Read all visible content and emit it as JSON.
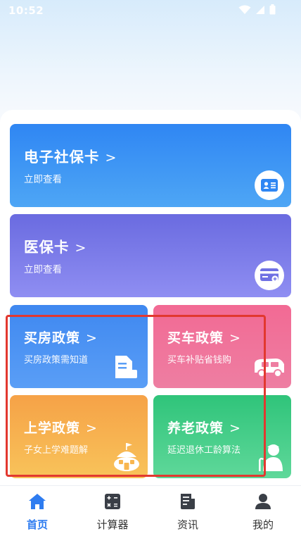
{
  "status_bar": {
    "time": "10:52"
  },
  "cards": {
    "social_security": {
      "title": "电子社保卡",
      "subtitle": "立即查看"
    },
    "medical": {
      "title": "医保卡",
      "subtitle": "立即查看"
    },
    "housing": {
      "title": "买房政策",
      "subtitle": "买房政策需知道"
    },
    "car": {
      "title": "买车政策",
      "subtitle": "买车补贴省钱购"
    },
    "school": {
      "title": "上学政策",
      "subtitle": "子女上学难题解"
    },
    "pension": {
      "title": "养老政策",
      "subtitle": "延迟退休工龄算法"
    }
  },
  "tabs": [
    {
      "label": "首页",
      "icon": "home-icon",
      "active": true
    },
    {
      "label": "计算器",
      "icon": "calculator-icon",
      "active": false
    },
    {
      "label": "资讯",
      "icon": "news-icon",
      "active": false
    },
    {
      "label": "我的",
      "icon": "profile-icon",
      "active": false
    }
  ],
  "colors": {
    "accent": "#2e7cf0",
    "highlight": "#e2382f",
    "social_card": "#2f86f3",
    "medical_card": "#6a6be0",
    "housing_card": "#3f88f0",
    "car_card": "#f26a94",
    "school_card": "#f6a247",
    "pension_card": "#2fc47a"
  }
}
